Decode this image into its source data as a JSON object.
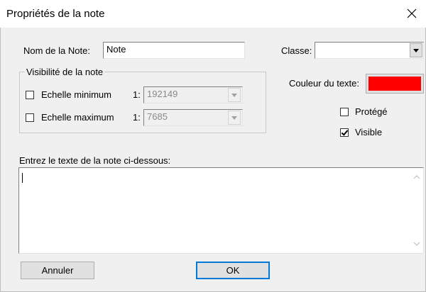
{
  "window": {
    "title": "Propriétés de la note",
    "close_glyph": "×"
  },
  "note_name": {
    "label": "Nom de la Note:",
    "value": "Note"
  },
  "classe": {
    "label": "Classe:",
    "value": ""
  },
  "visibility": {
    "legend": "Visibilité de la note",
    "min_label": "Echelle minimum",
    "min_checked": false,
    "min_prefix": "1:",
    "min_value": "192149",
    "max_label": "Echelle maximum",
    "max_checked": false,
    "max_prefix": "1:",
    "max_value": "7685"
  },
  "text_color": {
    "label": "Couleur du texte:",
    "color": "#ff0000"
  },
  "protege": {
    "label": "Protégé",
    "checked": false
  },
  "visible": {
    "label": "Visible",
    "checked": true
  },
  "note_text": {
    "label": "Entrez le texte de la note ci-dessous:",
    "value": ""
  },
  "buttons": {
    "cancel": "Annuler",
    "ok": "OK"
  },
  "icons": {
    "close": "close-icon",
    "dropdown": "chevron-down-icon",
    "scroll_up": "scroll-up-icon",
    "scroll_down": "scroll-down-icon"
  }
}
